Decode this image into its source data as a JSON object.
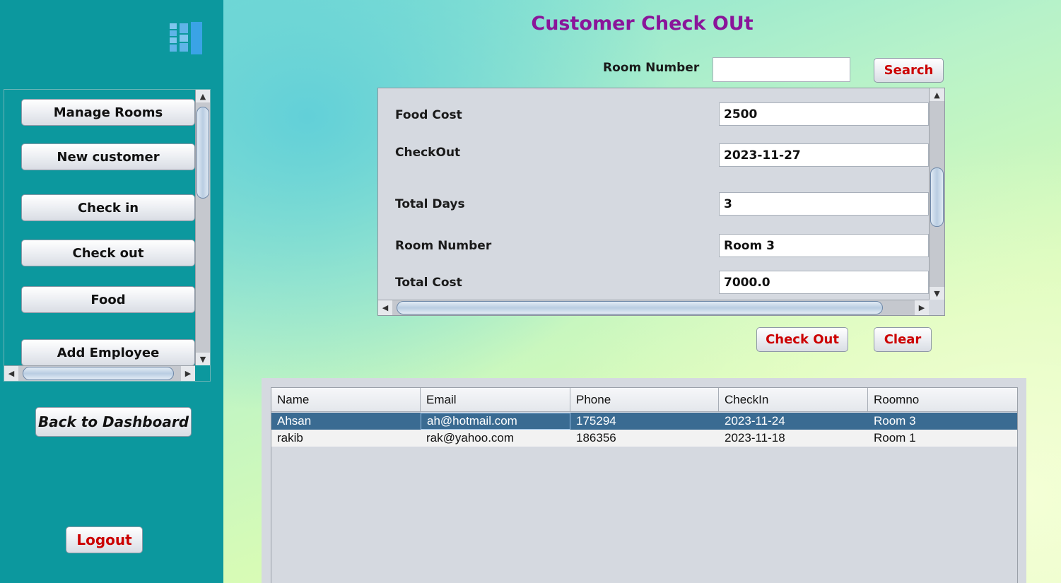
{
  "sidebar": {
    "logo_icon": "building-icon",
    "nav_items": [
      {
        "label": "Manage Rooms"
      },
      {
        "label": "New customer"
      },
      {
        "label": "Check in"
      },
      {
        "label": "Check out"
      },
      {
        "label": "Food"
      },
      {
        "label": "Add Employee"
      }
    ],
    "back_label": "Back to Dashboard",
    "logout_label": "Logout"
  },
  "main": {
    "title": "Customer Check OUt",
    "search": {
      "label": "Room Number",
      "value": "",
      "button_label": "Search"
    },
    "details": {
      "food_cost": {
        "label": "Food Cost",
        "value": "2500"
      },
      "checkout": {
        "label": "CheckOut",
        "value": "2023-11-27"
      },
      "total_days": {
        "label": "Total Days",
        "value": "3"
      },
      "room_number": {
        "label": "Room Number",
        "value": "Room 3"
      },
      "total_cost": {
        "label": "Total Cost",
        "value": "7000.0"
      }
    },
    "checkout_button": "Check Out",
    "clear_button": "Clear"
  },
  "table": {
    "columns": [
      "Name",
      "Email",
      "Phone",
      "CheckIn",
      "Roomno"
    ],
    "rows": [
      [
        "Ahsan",
        "ah@hotmail.com",
        "175294",
        "2023-11-24",
        "Room 3"
      ],
      [
        "rakib",
        "rak@yahoo.com",
        "186356",
        "2023-11-18",
        "Room 1"
      ]
    ],
    "selected_row": 0
  },
  "colors": {
    "sidebar_bg": "#0c989e",
    "title_color": "#8a159a",
    "accent_red": "#cc0000",
    "selection_blue": "#3a6b92"
  }
}
